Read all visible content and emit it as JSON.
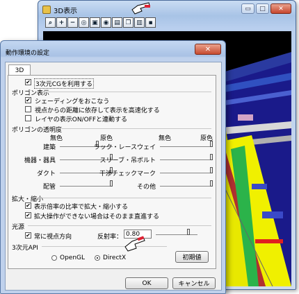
{
  "window3d": {
    "title": "3D表示",
    "toolbar_icons": [
      "zoom-region-icon",
      "zoom-in-icon",
      "zoom-out-icon",
      "zoom-fit-icon",
      "camera-icon",
      "eye-icon",
      "print-icon",
      "copy-icon",
      "paste-icon",
      "save-icon"
    ],
    "caption_buttons": {
      "minimize": "▭",
      "maximize": "□",
      "close": "✕"
    }
  },
  "dialog": {
    "title": "動作環境の設定",
    "close": "✕",
    "tab": "3D",
    "use_3dcg": {
      "label": "3次元CGを利用する",
      "checked": true
    },
    "polygon_display": {
      "heading": "ポリゴン表示",
      "shading": {
        "label": "シェーディングをおこなう",
        "checked": true
      },
      "fast_by_distance": {
        "label": "視点からの距離に依存して表示を高速化する",
        "checked": false
      },
      "layer_sync": {
        "label": "レイヤの表示ON/OFFと連動する",
        "checked": false
      }
    },
    "transparency": {
      "heading": "ポリゴンの透明度",
      "left_min": "無色",
      "left_max": "原色",
      "right_min": "無色",
      "right_max": "原色",
      "left_items": [
        "建築",
        "機器・器具",
        "ダクト",
        "配管"
      ],
      "right_items": [
        "ラック・レースウェイ",
        "スリーブ・吊ボルト",
        "干渉チェックマーク",
        "その他"
      ],
      "left_levels": [
        0.72,
        1.0,
        1.0,
        1.0
      ],
      "right_levels": [
        1.0,
        1.0,
        1.0,
        1.0
      ]
    },
    "zoom": {
      "heading": "拡大・縮小",
      "ratio": {
        "label": "表示倍率の比率で拡大・縮小する",
        "checked": true
      },
      "immediate": {
        "label": "拡大操作ができない場合はそのまま直進する",
        "checked": true
      }
    },
    "light": {
      "heading": "光源",
      "view_dir": {
        "label": "常に視点方向",
        "checked": true
      },
      "reflect_label": "反射率：",
      "reflect_value": "0.80",
      "reflect_level": 0.8
    },
    "api": {
      "heading": "3次元API",
      "opengl": "OpenGL",
      "directx": "DirectX",
      "selected": "DirectX"
    },
    "reset_button": "初期値",
    "ok_button": "OK",
    "cancel_button": "キャンセル"
  }
}
